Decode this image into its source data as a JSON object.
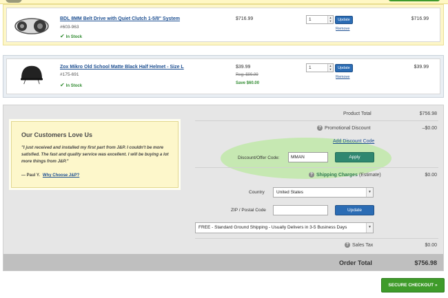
{
  "items": [
    {
      "title": "BDL 8MM Belt Drive with Quiet Clutch 1-5/8\" System",
      "sku": "#603-963",
      "stock": "In Stock",
      "price": "$716.99",
      "qty": "1",
      "update_label": "Update",
      "remove_label": "Remove",
      "total": "$716.99"
    },
    {
      "title": "Zox Mikro Old School Matte Black Half Helmet - Size L",
      "sku": "#175-691",
      "stock": "In Stock",
      "price": "$39.99",
      "reg_price": "Reg: $99.99",
      "save": "Save $60.00",
      "qty": "1",
      "update_label": "Update",
      "remove_label": "Remove",
      "total": "$39.99"
    }
  ],
  "testimonial": {
    "heading": "Our Customers Love Us",
    "quote": "\"I just received and installed my first part from J&P. I couldn't be more satisfied. The fast and quality service was excellent. I will be buying a lot more things from J&P.\"",
    "author": "— Paul Y.",
    "link": "Why Choose J&P?"
  },
  "summary": {
    "product_total_label": "Product Total",
    "product_total": "$756.98",
    "promo_label": "Promotional Discount",
    "promo_value": "–$0.00",
    "add_discount_link": "Add Discount Code",
    "discount_label": "Discount/Offer Code:",
    "discount_value": "MMAN",
    "apply_label": "Apply",
    "shipping_label": "Shipping Charges",
    "shipping_est": "(Estimate)",
    "shipping_value": "$0.00",
    "country_label": "Country",
    "country_value": "United States",
    "zip_label": "ZIP / Postal Code",
    "zip_value": "",
    "update_label": "Update",
    "shipping_method": "FREE - Standard Ground Shipping - Usually Delivers in 3-5 Business Days",
    "tax_label": "Sales Tax",
    "tax_value": "$0.00",
    "order_total_label": "Order Total",
    "order_total": "$756.98"
  },
  "checkout_label": "SECURE CHECKOUT »",
  "colors": {
    "link": "#1d4f91",
    "checkout_green": "#3f9b2a",
    "apply_teal": "#2f8770",
    "update_blue": "#2b6cb4"
  }
}
